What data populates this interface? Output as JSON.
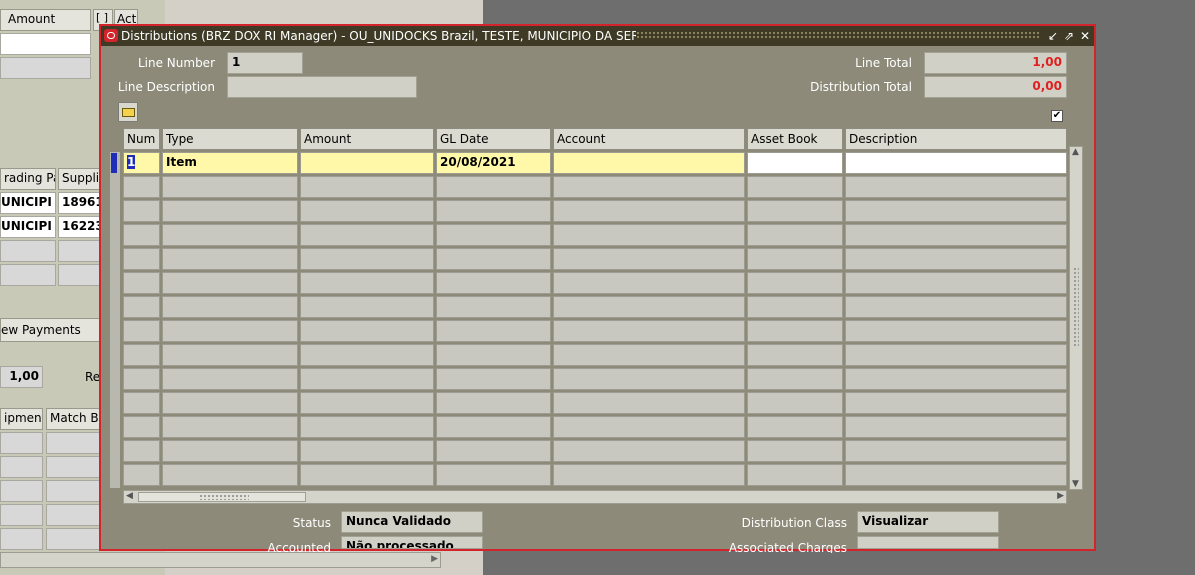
{
  "background": {
    "amount_header": "Amount",
    "col_bracket": "[ ]",
    "col_act": "Act",
    "trading_partner_header": "rading Pa",
    "supplier_header": "Supplie",
    "rows": [
      {
        "partner": "UNICIPI",
        "supplier": "18961"
      },
      {
        "partner": "UNICIPI",
        "supplier": "16223"
      }
    ],
    "view_payments_label": "ew Payments",
    "total_value": "1,00",
    "re_label": "Re",
    "shipment_header": "ipment",
    "match_header": "Match B"
  },
  "dialog": {
    "title": "Distributions (BRZ DOX RI Manager) - OU_UNIDOCKS Brazil, TESTE, MUNICIPIO DA SERRA",
    "line_number_label": "Line Number",
    "line_number_value": "1",
    "line_description_label": "Line Description",
    "line_description_value": "",
    "line_total_label": "Line Total",
    "line_total_value": "1,00",
    "distribution_total_label": "Distribution Total",
    "distribution_total_value": "0,00",
    "columns": [
      "Num",
      "Type",
      "Amount",
      "GL Date",
      "Account",
      "Asset Book",
      "Description"
    ],
    "first_row": {
      "num": "1",
      "type": "Item",
      "amount": "",
      "gl_date": "20/08/2021",
      "account": "",
      "asset_book": "",
      "description": ""
    },
    "status_label": "Status",
    "status_value": "Nunca Validado",
    "accounted_label": "Accounted",
    "accounted_value": "Não processado",
    "distribution_class_label": "Distribution Class",
    "distribution_class_value": "Visualizar",
    "associated_charges_label": "Associated Charges",
    "associated_charges_value": ""
  }
}
